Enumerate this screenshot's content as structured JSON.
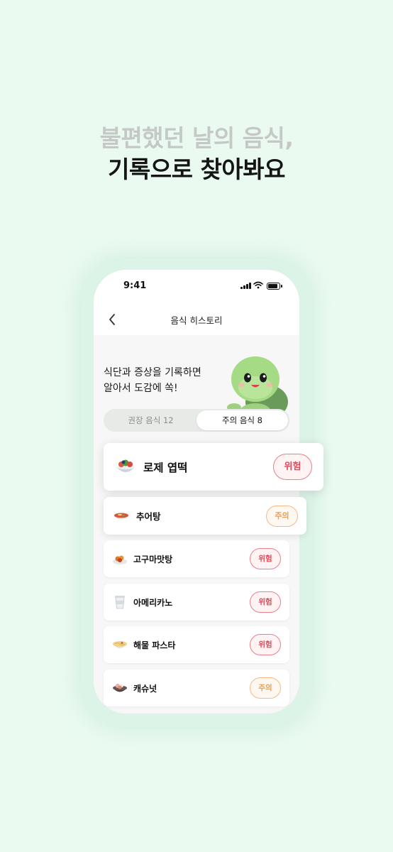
{
  "headline": {
    "line1": "불편했던 날의 음식,",
    "line2": "기록으로 찾아봐요"
  },
  "status_bar": {
    "time": "9:41"
  },
  "nav": {
    "title": "음식 히스토리"
  },
  "intro": {
    "line1": "식단과 증상을 기록하면",
    "line2": "알아서 도감에 쏙!"
  },
  "tabs": {
    "recommended": "권장 음식 12",
    "caution": "주의 음식 8",
    "active": "caution"
  },
  "foods": [
    {
      "name": "로제 엽떡",
      "badge": "위험",
      "level": "danger",
      "icon": "tteokbokki-bowl-icon"
    },
    {
      "name": "추어탕",
      "badge": "주의",
      "level": "caution",
      "icon": "soup-bowl-icon"
    },
    {
      "name": "고구마맛탕",
      "badge": "위험",
      "level": "danger",
      "icon": "sweet-potato-dish-icon"
    },
    {
      "name": "아메리카노",
      "badge": "위험",
      "level": "danger",
      "icon": "coffee-cup-icon"
    },
    {
      "name": "해물 파스타",
      "badge": "위험",
      "level": "danger",
      "icon": "pasta-plate-icon"
    },
    {
      "name": "캐슈넛",
      "badge": "주의",
      "level": "caution",
      "icon": "nuts-bowl-icon"
    }
  ],
  "colors": {
    "background": "#eafaf1",
    "danger": "#e04a5a",
    "caution": "#ec9d55",
    "mascot": "#a6db86"
  }
}
